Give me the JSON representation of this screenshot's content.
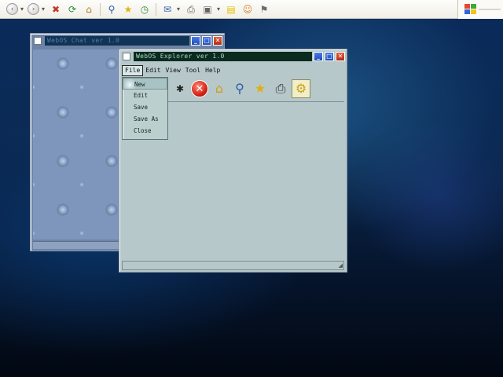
{
  "browser": {
    "toolbar_buttons": [
      {
        "name": "back-icon",
        "glyph": "‹"
      },
      {
        "name": "forward-icon",
        "glyph": "›"
      },
      {
        "name": "stop-icon",
        "glyph": "✖"
      },
      {
        "name": "refresh-icon",
        "glyph": "⟳"
      },
      {
        "name": "home-icon",
        "glyph": "⌂"
      },
      {
        "name": "search-icon",
        "glyph": "⚲"
      },
      {
        "name": "favorites-icon",
        "glyph": "★"
      },
      {
        "name": "history-icon",
        "glyph": "◷"
      },
      {
        "name": "mail-icon",
        "glyph": "✉"
      },
      {
        "name": "print-icon",
        "glyph": "⎙"
      },
      {
        "name": "edit-icon",
        "glyph": "▣"
      },
      {
        "name": "notes-icon",
        "glyph": "▤"
      },
      {
        "name": "messenger-icon",
        "glyph": "☺"
      }
    ]
  },
  "chat_window": {
    "title": "WebOS Chat ver 1.0"
  },
  "explorer_window": {
    "title": "WebOS Explorer ver 1.0",
    "menus": [
      "File",
      "Edit",
      "View",
      "Tool",
      "Help"
    ],
    "active_menu": "File",
    "toolbar_icons": [
      "forward-arrow-icon",
      "stop-icon",
      "home-icon",
      "search-icon",
      "favorites-icon",
      "print-icon",
      "settings-icon"
    ]
  },
  "file_menu": {
    "items": [
      "New",
      "Edit",
      "Save",
      "Save As",
      "Close"
    ],
    "highlighted": "New"
  },
  "colors": {
    "explorer_title_bg": "#0b2b1f",
    "chat_title_bg": "#0f3456",
    "close_button": "#c8381a",
    "min_max_button": "#2f5fd0"
  }
}
